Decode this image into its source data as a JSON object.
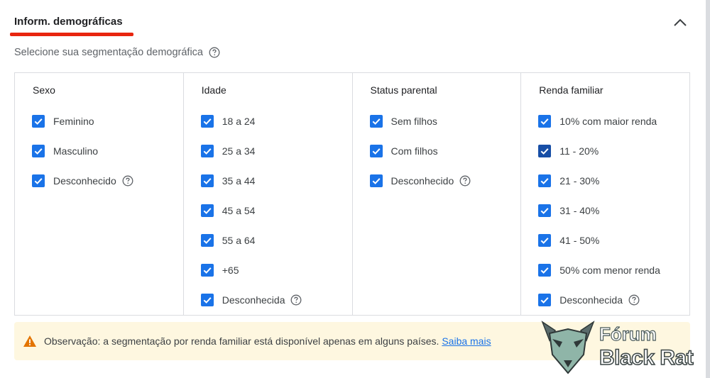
{
  "header": {
    "title": "Inform. demográficas"
  },
  "subtitle": "Selecione sua segmentação demográfica",
  "columns": [
    {
      "title": "Sexo",
      "options": [
        {
          "label": "Feminino",
          "checked": true
        },
        {
          "label": "Masculino",
          "checked": true
        },
        {
          "label": "Desconhecido",
          "checked": true,
          "help": true
        }
      ]
    },
    {
      "title": "Idade",
      "options": [
        {
          "label": "18 a 24",
          "checked": true
        },
        {
          "label": "25 a 34",
          "checked": true
        },
        {
          "label": "35 a 44",
          "checked": true
        },
        {
          "label": "45 a 54",
          "checked": true
        },
        {
          "label": "55 a 64",
          "checked": true
        },
        {
          "label": "+65",
          "checked": true
        },
        {
          "label": "Desconhecida",
          "checked": true,
          "help": true
        }
      ]
    },
    {
      "title": "Status parental",
      "options": [
        {
          "label": "Sem filhos",
          "checked": true
        },
        {
          "label": "Com filhos",
          "checked": true
        },
        {
          "label": "Desconhecido",
          "checked": true,
          "help": true
        }
      ]
    },
    {
      "title": "Renda familiar",
      "options": [
        {
          "label": "10% com maior renda",
          "checked": true
        },
        {
          "label": "11 - 20%",
          "checked": true,
          "focused": true
        },
        {
          "label": "21 - 30%",
          "checked": true
        },
        {
          "label": "31 - 40%",
          "checked": true
        },
        {
          "label": "41 - 50%",
          "checked": true
        },
        {
          "label": "50% com menor renda",
          "checked": true
        },
        {
          "label": "Desconhecida",
          "checked": true,
          "help": true
        }
      ]
    }
  ],
  "note": {
    "text": "Observação: a segmentação por renda familiar está disponível apenas em alguns países.",
    "link": "Saiba mais"
  },
  "watermark": {
    "line1": "Fórum",
    "line2": "Black Rat"
  },
  "colors": {
    "accent": "#1a73e8",
    "underline": "#e8260f",
    "warning": "#e37400",
    "note_bg": "#fef7e0"
  }
}
